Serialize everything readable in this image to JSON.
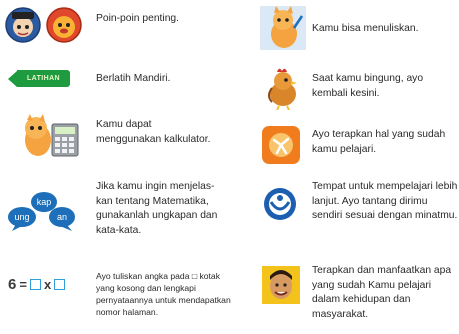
{
  "legend": {
    "left": [
      {
        "id": "important",
        "text": "Poin-poin penting."
      },
      {
        "id": "latihan",
        "tag": "LATIHAN",
        "text": "Berlatih Mandiri."
      },
      {
        "id": "calculator",
        "text": "Kamu dapat menggunakan kalkulator."
      },
      {
        "id": "speech",
        "bubbles": [
          "kap",
          "ung",
          "an"
        ],
        "text": "Jika kamu ingin menjelas-kan tentang Matematika, gunakanlah ungkapan dan kata-kata."
      },
      {
        "id": "puzzle",
        "formula": {
          "left": "6",
          "eq": "=",
          "op": "x"
        },
        "text": "Ayo tuliskan angka pada □ kotak yang kosong dan lengkapi pernyataannya untuk mendapatkan nomor halaman."
      }
    ],
    "right": [
      {
        "id": "write",
        "text": "Kamu bisa menuliskan."
      },
      {
        "id": "confused",
        "text": "Saat kamu bingung, ayo kembali kesini."
      },
      {
        "id": "apply",
        "text": "Ayo terapkan hal yang sudah kamu pelajari."
      },
      {
        "id": "further",
        "text": "Tempat untuk mempelajari lebih lanjut. Ayo tantang dirimu sendiri sesuai dengan minatmu."
      },
      {
        "id": "daily",
        "text": "Terapkan dan manfaatkan apa yang sudah Kamu pelajari dalam kehidupan dan masyarakat."
      }
    ]
  },
  "colors": {
    "latihan_green": "#1d9b3e",
    "bubble_blue": "#1c6fb8",
    "square_blue": "#2f9fd8",
    "apply_orange": "#f07c1e"
  }
}
